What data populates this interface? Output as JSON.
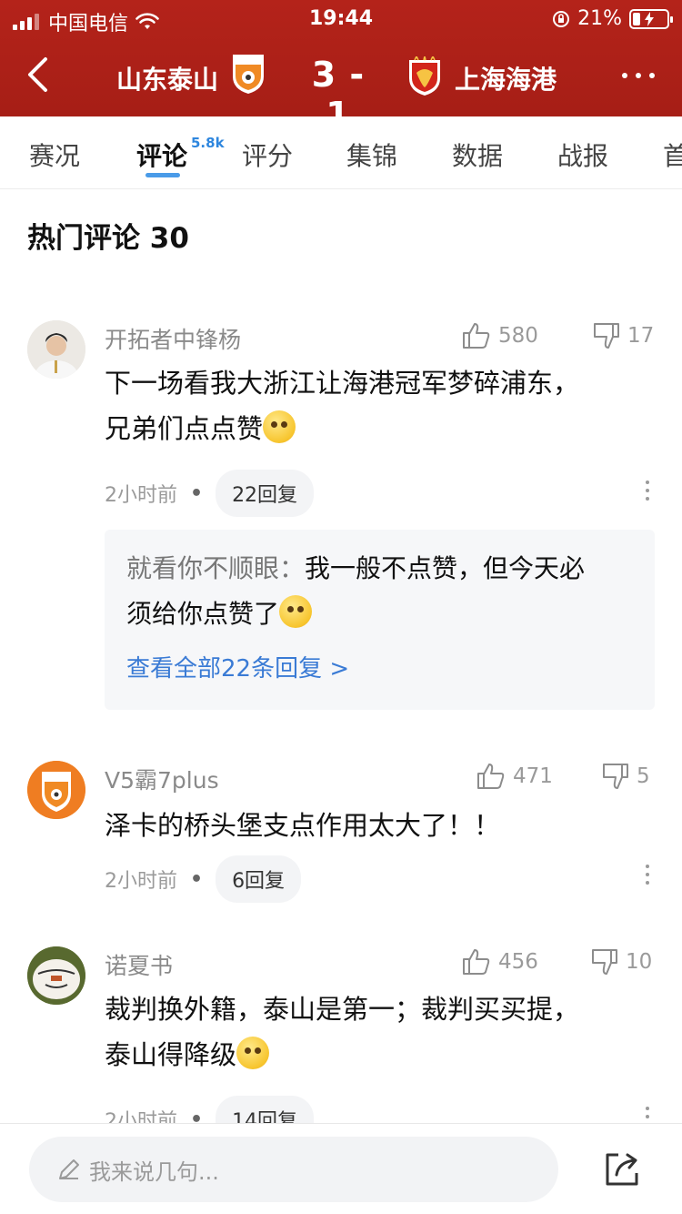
{
  "status_bar": {
    "carrier": "中国电信",
    "time": "19:44",
    "battery": "21%"
  },
  "match": {
    "home_team": "山东泰山",
    "score": "3 - 1",
    "away_team": "上海海港"
  },
  "tabs": [
    {
      "label": "赛况"
    },
    {
      "label": "评论",
      "badge": "5.8k",
      "active": true
    },
    {
      "label": "评分"
    },
    {
      "label": "集锦"
    },
    {
      "label": "数据"
    },
    {
      "label": "战报"
    },
    {
      "label": "首"
    }
  ],
  "section_title": "热门评论 30",
  "comments": [
    {
      "username": "开拓者中锋杨",
      "likes": "580",
      "dislikes": "17",
      "text_line1": "下一场看我大浙江让海港冠军梦碎浦东，",
      "text_line2": "兄弟们点点赞",
      "time": "2小时前",
      "replies": "22回复",
      "top_reply": {
        "author": "就看你不顺眼：",
        "text_line1": "我一般不点赞，但今天必",
        "text_line2": "须给你点赞了"
      },
      "view_all": "查看全部22条回复 >"
    },
    {
      "username": "V5霸7plus",
      "likes": "471",
      "dislikes": "5",
      "text_line1": "泽卡的桥头堡支点作用太大了！！",
      "time": "2小时前",
      "replies": "6回复"
    },
    {
      "username": "诺夏书",
      "likes": "456",
      "dislikes": "10",
      "text_line1": "裁判换外籍，泰山是第一；裁判买买提，",
      "text_line2": "泰山得降级",
      "time": "2小时前",
      "replies": "14回复"
    }
  ],
  "input": {
    "placeholder": "我来说几句..."
  },
  "colors": {
    "header_red": "#b4231a",
    "accent_blue": "#4a9be8",
    "link_blue": "#3a7bd5"
  }
}
